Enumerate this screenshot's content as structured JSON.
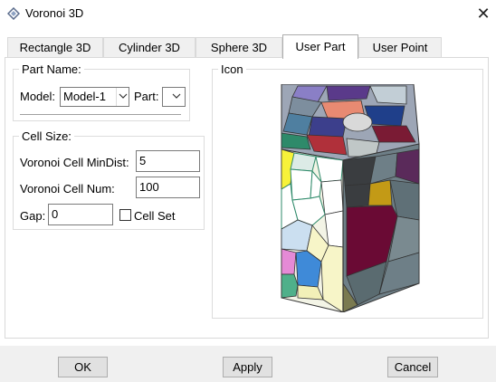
{
  "window": {
    "title": "Voronoi 3D",
    "close_glyph": "✕"
  },
  "tabs": [
    {
      "label": "Rectangle 3D",
      "active": false
    },
    {
      "label": "Cylinder 3D",
      "active": false
    },
    {
      "label": "Sphere 3D",
      "active": false
    },
    {
      "label": "User Part",
      "active": true
    },
    {
      "label": "User Point",
      "active": false
    }
  ],
  "part_name": {
    "group_label": "Part Name:",
    "model_label": "Model:",
    "model_value": "Model-1",
    "part_label": "Part:",
    "part_value": ""
  },
  "cell_size": {
    "group_label": "Cell Size:",
    "min_dist_label": "Voronoi Cell MinDist:",
    "min_dist_value": "5",
    "num_label": "Voronoi Cell Num:",
    "num_value": "100",
    "gap_label": "Gap:",
    "gap_value": "0",
    "cell_set_label": "Cell Set",
    "cell_set_checked": false
  },
  "icon_group": {
    "label": "Icon"
  },
  "buttons": {
    "ok": "OK",
    "apply": "Apply",
    "cancel": "Cancel"
  },
  "icons": {
    "app": "voronoi-app-icon",
    "dropdown": "chevron-down-icon",
    "preview": "voronoi-3d-preview"
  },
  "colors": {
    "window_bg": "#ffffff",
    "panel_border": "#d9d9d9",
    "button_bg": "#e1e1e1",
    "bottom_bar_bg": "#f0f0f0"
  }
}
